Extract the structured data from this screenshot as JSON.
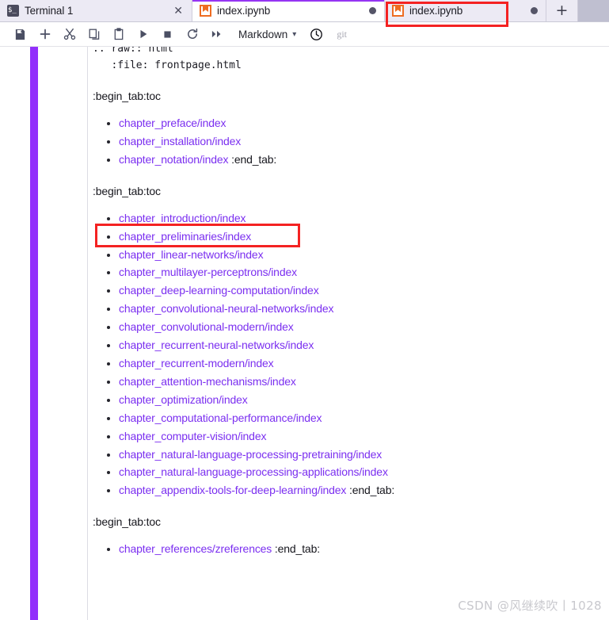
{
  "tabs": [
    {
      "label": "Terminal 1",
      "icon": "terminal-icon",
      "active": false,
      "closable": true,
      "dirty": false
    },
    {
      "label": "index.ipynb",
      "icon": "notebook-icon",
      "active": true,
      "closable": false,
      "dirty": true
    },
    {
      "label": "index.ipynb",
      "icon": "notebook-icon",
      "active": false,
      "closable": false,
      "dirty": true
    }
  ],
  "tabbar": {
    "close_glyph": "✕",
    "add_label": "+"
  },
  "toolbar": {
    "buttons": [
      {
        "name": "save-button",
        "title": "Save"
      },
      {
        "name": "insert-cell-button",
        "title": "Insert a cell below"
      },
      {
        "name": "cut-button",
        "title": "Cut"
      },
      {
        "name": "copy-button",
        "title": "Copy"
      },
      {
        "name": "paste-button",
        "title": "Paste"
      },
      {
        "name": "run-button",
        "title": "Run"
      },
      {
        "name": "stop-button",
        "title": "Interrupt"
      },
      {
        "name": "restart-button",
        "title": "Restart"
      },
      {
        "name": "run-all-button",
        "title": "Restart and run all"
      }
    ],
    "cell_type": "Markdown",
    "chevron": "⌄",
    "git_label": "git"
  },
  "notebook": {
    "raw_lines": [
      ".. raw:: html",
      "   :file: frontpage.html"
    ],
    "sections": [
      {
        "begin": ":begin_tab:toc",
        "items": [
          {
            "link": "chapter_preface/index",
            "suffix": ""
          },
          {
            "link": "chapter_installation/index",
            "suffix": ""
          },
          {
            "link": "chapter_notation/index",
            "suffix": " :end_tab:"
          }
        ]
      },
      {
        "begin": ":begin_tab:toc",
        "items": [
          {
            "link": "chapter_introduction/index",
            "suffix": ""
          },
          {
            "link": "chapter_preliminaries/index",
            "suffix": ""
          },
          {
            "link": "chapter_linear-networks/index",
            "suffix": ""
          },
          {
            "link": "chapter_multilayer-perceptrons/index",
            "suffix": ""
          },
          {
            "link": "chapter_deep-learning-computation/index",
            "suffix": ""
          },
          {
            "link": "chapter_convolutional-neural-networks/index",
            "suffix": ""
          },
          {
            "link": "chapter_convolutional-modern/index",
            "suffix": ""
          },
          {
            "link": "chapter_recurrent-neural-networks/index",
            "suffix": ""
          },
          {
            "link": "chapter_recurrent-modern/index",
            "suffix": ""
          },
          {
            "link": "chapter_attention-mechanisms/index",
            "suffix": ""
          },
          {
            "link": "chapter_optimization/index",
            "suffix": ""
          },
          {
            "link": "chapter_computational-performance/index",
            "suffix": ""
          },
          {
            "link": "chapter_computer-vision/index",
            "suffix": ""
          },
          {
            "link": "chapter_natural-language-processing-pretraining/index",
            "suffix": ""
          },
          {
            "link": "chapter_natural-language-processing-applications/index",
            "suffix": ""
          },
          {
            "link": "chapter_appendix-tools-for-deep-learning/index",
            "suffix": " :end_tab:"
          }
        ]
      },
      {
        "begin": ":begin_tab:toc",
        "items": [
          {
            "link": "chapter_references/zreferences",
            "suffix": " :end_tab:"
          }
        ]
      }
    ]
  },
  "annotations": [
    {
      "name": "highlight-tab-index-ipynb",
      "target": "third tab index.ipynb"
    },
    {
      "name": "highlight-chapter-introduction",
      "target": "chapter_introduction/index"
    }
  ],
  "watermark": "CSDN @风继续吹丨1028",
  "colors": {
    "accent_purple": "#9230fb",
    "link_purple": "#7b2ff0",
    "tabbar_bg": "#bfbfd0",
    "tab_bg": "#eceaf4",
    "notebook_icon": "#ee6c21",
    "annotation_red": "#f42222"
  }
}
